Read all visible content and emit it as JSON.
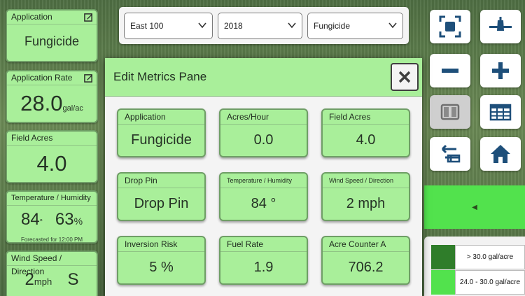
{
  "left_tiles": {
    "application": {
      "label": "Application",
      "value": "Fungicide"
    },
    "application_rate": {
      "label": "Application Rate",
      "value": "28.0",
      "unit": "gal/ac"
    },
    "field_acres": {
      "label": "Field Acres",
      "value": "4.0"
    },
    "temp_humidity": {
      "label": "Temperature / Humidity",
      "temp": "84",
      "temp_unit": "°",
      "humidity": "63",
      "humidity_unit": "%",
      "forecast": "Forecasted for 12:00 PM"
    },
    "wind": {
      "label": "Wind Speed / Direction",
      "speed": "2",
      "speed_unit": "mph",
      "direction": "S"
    }
  },
  "topbar": {
    "field": "East 100",
    "year": "2018",
    "product": "Fungicide"
  },
  "modal": {
    "title": "Edit Metrics Pane",
    "metrics": [
      {
        "label": "Application",
        "value": "Fungicide"
      },
      {
        "label": "Acres/Hour",
        "value": "0.0"
      },
      {
        "label": "Field Acres",
        "value": "4.0"
      },
      {
        "label": "Drop Pin",
        "value": "Drop Pin"
      },
      {
        "label": "Temperature / Humidity",
        "value": "84 °"
      },
      {
        "label": "Wind Speed / Direction",
        "value": "2 mph"
      },
      {
        "label": "Inversion Risk",
        "value": "5 %"
      },
      {
        "label": "Fuel Rate",
        "value": "1.9"
      },
      {
        "label": "Acre Counter A",
        "value": "706.2"
      }
    ]
  },
  "legend": {
    "items": [
      {
        "label": "> 30.0 gal/acre",
        "color": "#2f7d2a"
      },
      {
        "label": "24.0 - 30.0 gal/acre",
        "color": "#52e24d"
      }
    ]
  },
  "colors": {
    "tile_green": "#a9ef9a",
    "band_green": "#52e24d",
    "icon_blue": "#1e4f7a"
  }
}
